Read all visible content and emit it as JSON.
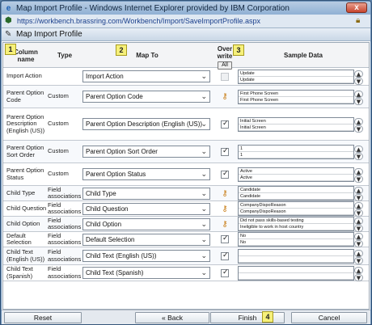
{
  "window": {
    "title": "Map Import Profile - Windows Internet Explorer provided by IBM Corporation",
    "url": "https://workbench.brassring.com/Workbench/Import/SaveImportProfile.aspx",
    "close_label": "x"
  },
  "page": {
    "title": "Map Import Profile"
  },
  "columns": {
    "name": "Column name",
    "type": "Type",
    "map_to": "Map To",
    "overwrite": "Over write",
    "all_button": "All",
    "sample": "Sample Data"
  },
  "callouts": [
    "1",
    "2",
    "3",
    "4"
  ],
  "rows": [
    {
      "name": "Import Action",
      "type": "",
      "map": "Import Action",
      "ow": "disabled",
      "sample": [
        "Update",
        "Update"
      ]
    },
    {
      "name": "Parent Option Code",
      "type": "Custom",
      "map": "Parent Option Code",
      "ow": "key",
      "sample": [
        "First Phone Screen",
        "First Phone Screen"
      ]
    },
    {
      "name": "Parent Option Description (English (US))",
      "type": "Custom",
      "map": "Parent Option Description (English (US))",
      "ow": "checked",
      "sample": [
        "Initial Screen",
        "Initial Screen"
      ]
    },
    {
      "name": "Parent Option Sort Order",
      "type": "Custom",
      "map": "Parent Option Sort Order",
      "ow": "checked",
      "sample": [
        "1",
        "1"
      ]
    },
    {
      "name": "Parent Option Status",
      "type": "Custom",
      "map": "Parent Option Status",
      "ow": "checked",
      "sample": [
        "Active",
        "Active"
      ]
    },
    {
      "name": "Child Type",
      "type": "Field associations",
      "map": "Child Type",
      "ow": "key",
      "sample": [
        "Candidate",
        "Candidate"
      ]
    },
    {
      "name": "Child Question",
      "type": "Field associations",
      "map": "Child Question",
      "ow": "key",
      "sample": [
        "CompanyDispoReason",
        "CompanyDispoReason"
      ]
    },
    {
      "name": "Child Option",
      "type": "Field associations",
      "map": "Child Option",
      "ow": "key",
      "sample": [
        "Did not pass skills-based testing",
        "Ineligible to work in host country"
      ]
    },
    {
      "name": "Default Selection",
      "type": "Field associations",
      "map": "Default Selection",
      "ow": "checked",
      "sample": [
        "No",
        "No"
      ]
    },
    {
      "name": "Child Text (English (US))",
      "type": "Field associations",
      "map": "Child Text (English (US))",
      "ow": "checked",
      "sample": [
        "",
        ""
      ]
    },
    {
      "name": "Child Text (Spanish)",
      "type": "Field associations",
      "map": "Child Text (Spanish)",
      "ow": "checked",
      "sample": [
        "",
        ""
      ]
    }
  ],
  "footer": {
    "reset": "Reset",
    "back": "« Back",
    "finish": "Finish",
    "cancel": "Cancel"
  }
}
